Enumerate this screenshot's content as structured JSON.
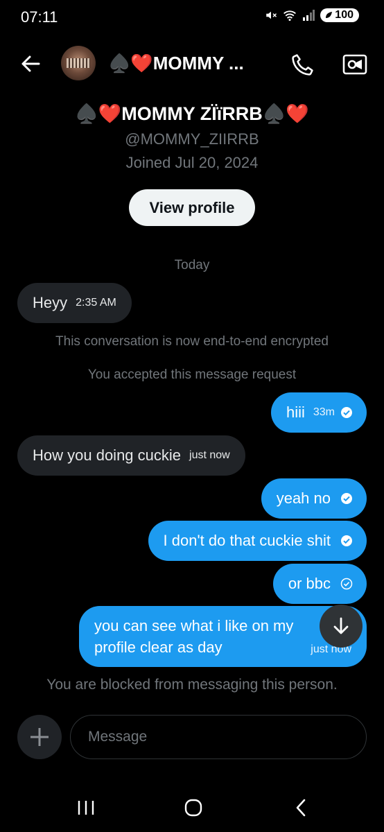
{
  "status_bar": {
    "time": "07:11",
    "battery": "100"
  },
  "header": {
    "title": "♠️❤️MOMMY ..."
  },
  "profile": {
    "name": "♠️❤️MOMMY ZÏïRRB♠️❤️",
    "handle": "@MOMMY_ZIIRRB",
    "joined": "Joined Jul 20, 2024",
    "view_profile_label": "View profile"
  },
  "conversation": {
    "day_separator": "Today",
    "notice_encrypted": "This conversation is now end-to-end encrypted",
    "notice_accepted": "You accepted this message request",
    "messages": [
      {
        "dir": "in",
        "text": "Heyy",
        "time": "2:35 AM"
      },
      {
        "dir": "out",
        "text": "hiii",
        "time": "33m",
        "status": "read"
      },
      {
        "dir": "in",
        "text": "How you doing cuckie",
        "time": "just now"
      },
      {
        "dir": "out",
        "text": "yeah no",
        "status": "read"
      },
      {
        "dir": "out",
        "text": "I don't do that cuckie shit",
        "status": "read"
      },
      {
        "dir": "out",
        "text": "or bbc",
        "status": "sent"
      },
      {
        "dir": "out",
        "text_line1": "you can see what i like on my",
        "text_line2": "profile clear as day",
        "time": "just now"
      }
    ],
    "blocked_notice": "You are blocked from messaging this person."
  },
  "composer": {
    "placeholder": "Message"
  },
  "icons": [
    "arrow-left-icon",
    "phone-icon",
    "video-icon",
    "check-circle-icon",
    "arrow-down-icon",
    "plus-icon",
    "recents-icon",
    "home-icon",
    "back-icon"
  ],
  "colors": {
    "background": "#000000",
    "incoming_bubble": "#202327",
    "outgoing_bubble": "#1d9bf0",
    "muted_text": "#71767b"
  }
}
